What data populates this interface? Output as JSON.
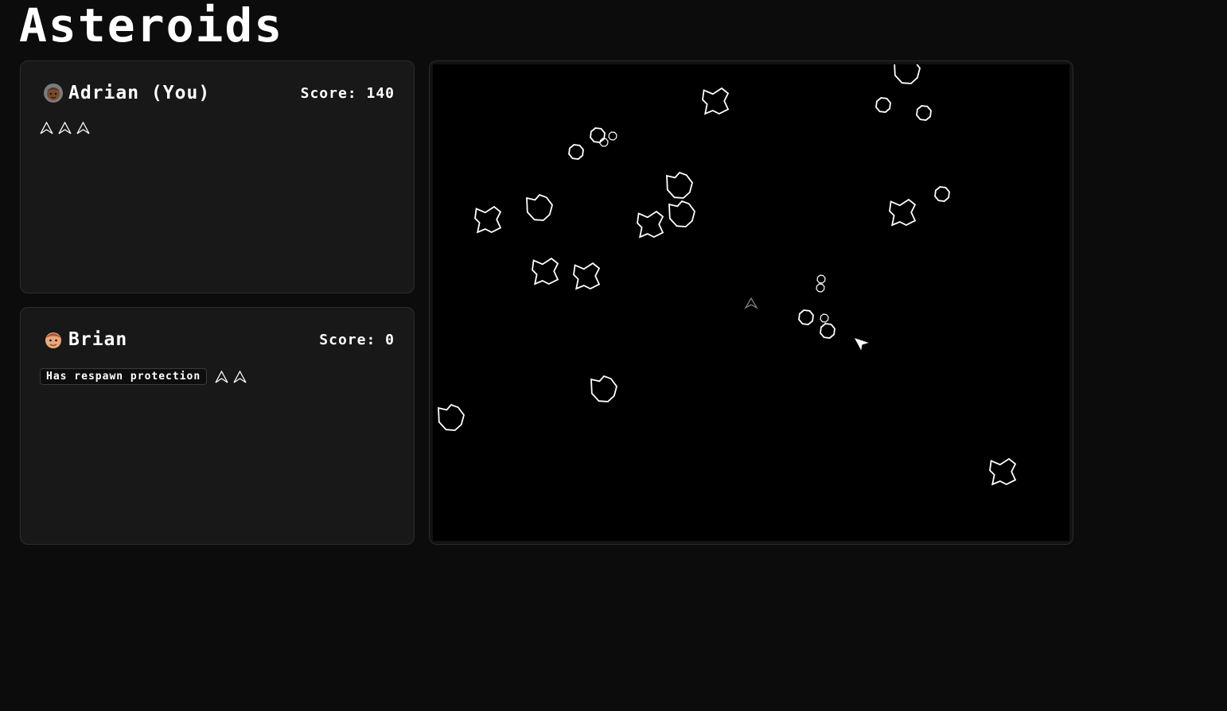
{
  "title": "Asteroids",
  "players": [
    {
      "name": "Adrian (You)",
      "score": "Score: 140",
      "lives": 3,
      "status": "",
      "avatar_icon": "avatar-adrian-icon"
    },
    {
      "name": "Brian",
      "score": "Score: 0",
      "lives": 2,
      "status": "Has respawn protection",
      "avatar_icon": "avatar-brian-icon"
    }
  ],
  "game": {
    "colors": {
      "asteroid": "#ffffff",
      "ship": "#ffffff",
      "ship_protected": "#7a7a7a",
      "background": "#000000"
    },
    "asteroid_sizes": [
      "large",
      "medium",
      "small",
      "tiny"
    ]
  }
}
